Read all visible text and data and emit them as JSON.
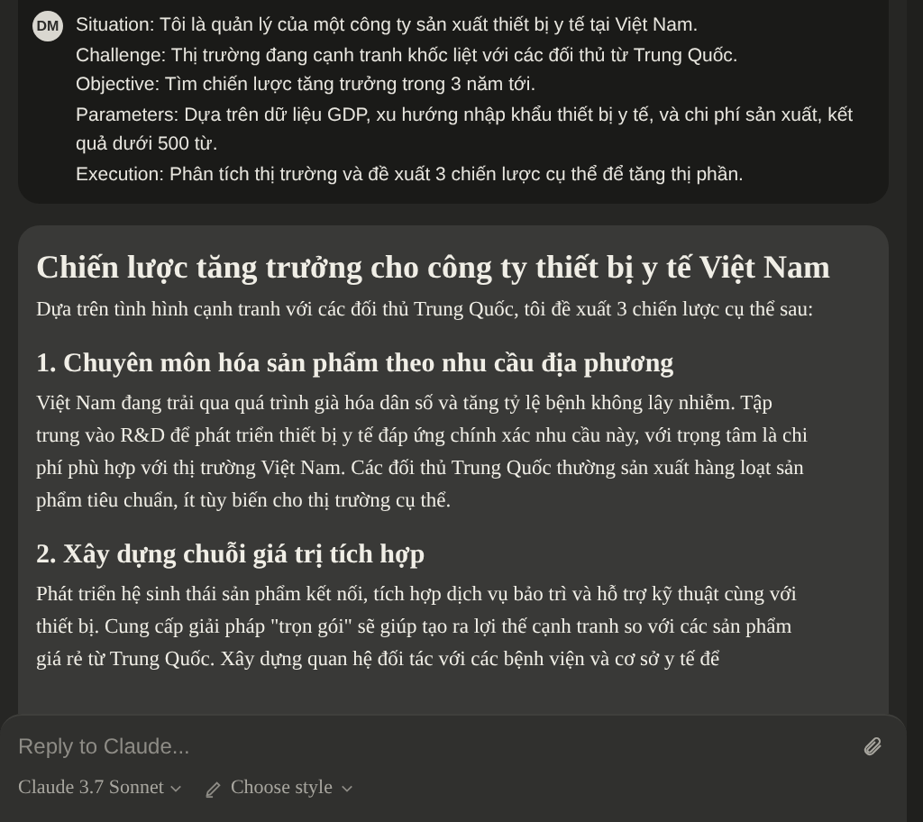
{
  "user_message": {
    "avatar": "DM",
    "lines": [
      "Situation: Tôi là quản lý của một công ty sản xuất thiết bị y tế tại Việt Nam.",
      "Challenge: Thị trường đang cạnh tranh khốc liệt với các đối thủ từ Trung Quốc.",
      "Objective: Tìm chiến lược tăng trưởng trong 3 năm tới.",
      "Parameters: Dựa trên dữ liệu GDP, xu hướng nhập khẩu thiết bị y tế, và chi phí sản xuất, kết quả dưới 500 từ.",
      "Execution: Phân tích thị trường và đề xuất 3 chiến lược cụ thể để tăng thị phần."
    ]
  },
  "response": {
    "title": "Chiến lược tăng trưởng cho công ty thiết bị y tế Việt Nam",
    "blocks": [
      {
        "kind": "paragraph",
        "text": "Dựa trên tình hình cạnh tranh với các đối thủ Trung Quốc, tôi đề xuất 3 chiến lược cụ thể sau:"
      },
      {
        "kind": "heading",
        "text": "1. Chuyên môn hóa sản phẩm theo nhu cầu địa phương"
      },
      {
        "kind": "paragraph",
        "text": "Việt Nam đang trải qua quá trình già hóa dân số và tăng tỷ lệ bệnh không lây nhiễm. Tập trung vào R&D để phát triển thiết bị y tế đáp ứng chính xác nhu cầu này, với trọng tâm là chi phí phù hợp với thị trường Việt Nam. Các đối thủ Trung Quốc thường sản xuất hàng loạt sản phẩm tiêu chuẩn, ít tùy biến cho thị trường cụ thể."
      },
      {
        "kind": "heading",
        "text": "2. Xây dựng chuỗi giá trị tích hợp"
      },
      {
        "kind": "paragraph",
        "text": "Phát triển hệ sinh thái sản phẩm kết nối, tích hợp dịch vụ bảo trì và hỗ trợ kỹ thuật cùng với thiết bị. Cung cấp giải pháp \"trọn gói\" sẽ giúp tạo ra lợi thế cạnh tranh so với các sản phẩm giá rẻ từ Trung Quốc. Xây dựng quan hệ đối tác với các bệnh viện và cơ sở y tế để"
      }
    ]
  },
  "composer": {
    "placeholder": "Reply to Claude...",
    "model": "Claude 3.7 Sonnet",
    "style": "Choose style"
  }
}
